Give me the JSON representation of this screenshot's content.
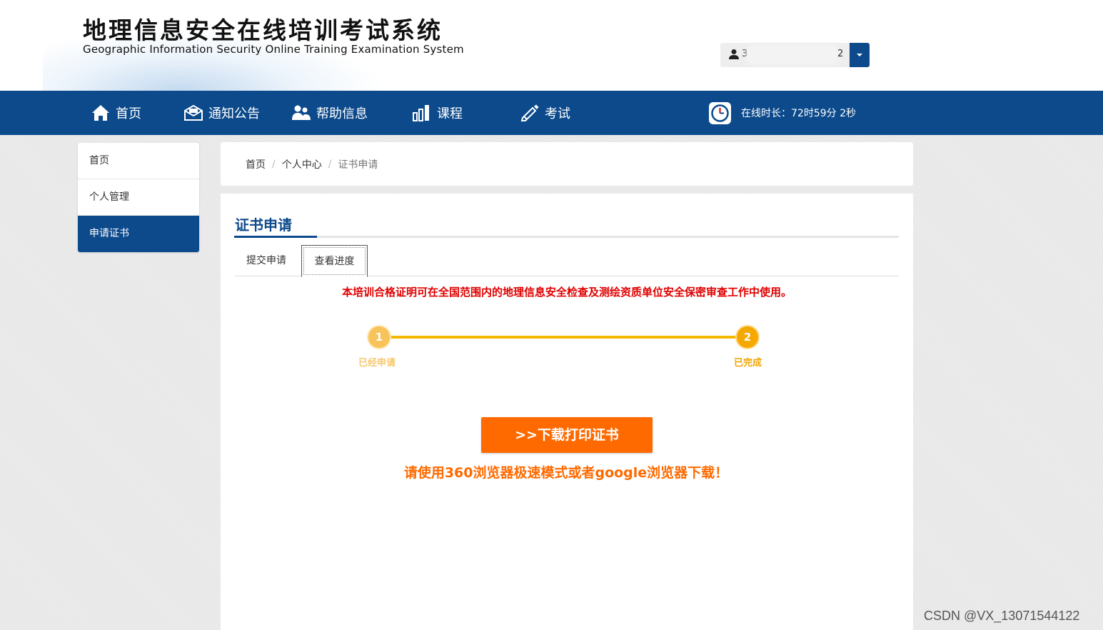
{
  "header": {
    "title_cn": "地理信息安全在线培训考试系统",
    "title_en": "Geographic Information Security Online Training Examination System",
    "user": {
      "name_partial": "3",
      "name_tail": "2"
    }
  },
  "nav": {
    "items": [
      {
        "label": "首页",
        "icon": "home-icon"
      },
      {
        "label": "通知公告",
        "icon": "envelope-icon"
      },
      {
        "label": "帮助信息",
        "icon": "users-icon"
      },
      {
        "label": "课程",
        "icon": "bar-chart-icon"
      },
      {
        "label": "考试",
        "icon": "pencil-icon"
      }
    ],
    "online_time": "在线时长：72时59分 2秒"
  },
  "sidebar": {
    "items": [
      {
        "label": "首页"
      },
      {
        "label": "个人管理"
      },
      {
        "label": "申请证书"
      }
    ]
  },
  "breadcrumb": {
    "items": [
      "首页",
      "个人中心",
      "证书申请"
    ],
    "separator": "/"
  },
  "main": {
    "title": "证书申请",
    "tabs": [
      {
        "label": "提交申请"
      },
      {
        "label": "查看进度"
      }
    ],
    "notice": "本培训合格证明可在全国范围内的地理信息安全检查及测绘资质单位安全保密审查工作中使用。",
    "steps": [
      {
        "number": "1",
        "label": "已经申请"
      },
      {
        "number": "2",
        "label": "已完成"
      }
    ],
    "download_label": ">>下载打印证书",
    "tip": "请使用360浏览器极速模式或者google浏览器下载！"
  },
  "watermark": "CSDN @VX_13071544122",
  "colors": {
    "primary": "#0c4a8c",
    "notice_red": "#e00000",
    "accent_orange": "#ff6a00",
    "step_yellow": "#f5b800"
  }
}
